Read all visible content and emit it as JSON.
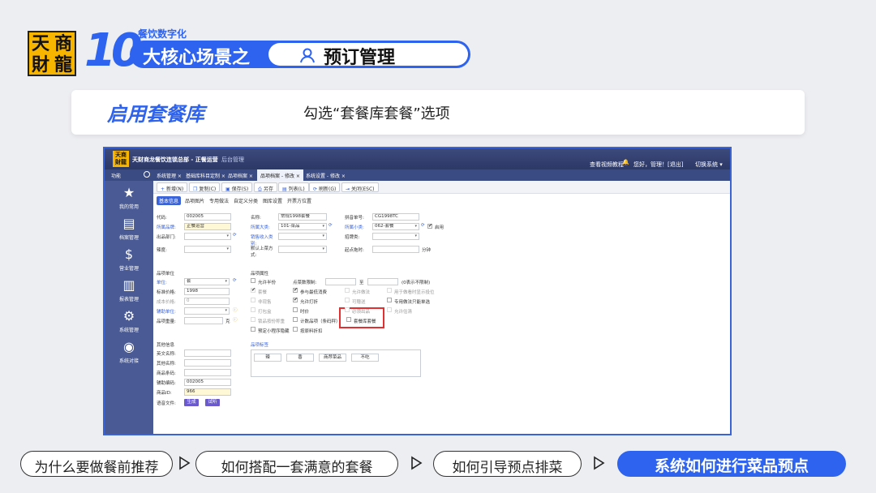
{
  "slide": {
    "logo_chars": [
      "天",
      "商",
      "財",
      "龍"
    ],
    "number": "10",
    "caption": "餐饮数字化",
    "headline": "大核心场景之",
    "scene": "预订管理",
    "section_title": "启用套餐库",
    "instruction": "勾选“套餐库套餐”选项"
  },
  "colors": {
    "accent": "#2e63f0",
    "highlight": "#e23030",
    "sidebar": "#4a5a94"
  },
  "app": {
    "title": "天财商龙餐饮连锁总部 - 正餐运营",
    "title_suffix": "后台管理",
    "help": "查看视频教程",
    "greeting": "您好，管理！[退出]",
    "switch": "切换系统 ▾",
    "function_label": "功能",
    "tabs": [
      "系统管理 ×",
      "基础库科目定制 ×",
      "品项档案 ×",
      "品项档案 - 修改 ×",
      "系统设置 - 修改 ×"
    ],
    "sidebar": [
      {
        "icon": "★",
        "icon_name": "star-icon",
        "label": "我的常用"
      },
      {
        "icon": "▤",
        "icon_name": "list-icon",
        "label": "档案管理"
      },
      {
        "icon": "$",
        "icon_name": "money-bag-icon",
        "label": "营业管理"
      },
      {
        "icon": "▥",
        "icon_name": "report-icon",
        "label": "报表管理"
      },
      {
        "icon": "⚙",
        "icon_name": "gears-icon",
        "label": "系统管理"
      },
      {
        "icon": "◉",
        "icon_name": "dashboard-icon",
        "label": "系统对接"
      }
    ],
    "toolbar": [
      {
        "icon": "+",
        "label": "新增(N)"
      },
      {
        "icon": "❐",
        "label": "复制(C)"
      },
      {
        "icon": "▣",
        "label": "保存(S)"
      },
      {
        "icon": "⎙",
        "label": "另存"
      },
      {
        "icon": "▤",
        "label": "列表(L)"
      },
      {
        "icon": "⟳",
        "label": "刷新(G)"
      },
      {
        "icon": "⇥",
        "label": "关闭(ESC)"
      }
    ],
    "subtabs": [
      "基本信息",
      "品项图片",
      "专用做法",
      "自定义分类",
      "图库设置",
      "开票方位置"
    ],
    "form": {
      "code_label": "代码:",
      "code": "002005",
      "name_label": "名称:",
      "name": "常规1998套餐",
      "pinyin_label": "拼音单号:",
      "pinyin": "CG1998TC",
      "brand_label": "所属品牌:",
      "brand": "正餐运营",
      "bigcat_label": "所属大类:",
      "bigcat": "101-菜品",
      "smallcat_label": "所属小类:",
      "smallcat": "062-套餐",
      "enabled": "启用",
      "dept_label": "出品部门:",
      "sell_label": "销售收入类别:",
      "tag_label": "招牌类:",
      "temp_label": "辣度:",
      "serve_label": "默认上菜方式:",
      "time_label": "起点拖时:",
      "minutes": "分钟",
      "unit_section": "品项单位",
      "unit_label": "单位:",
      "unit": "套",
      "price_label": "标准价格:",
      "price": "1998",
      "cost_label": "成本价格:",
      "cost": "0",
      "aux_label": "辅助单位:",
      "weight_label": "品项重量:",
      "weight_unit": "克",
      "prop_section": "品项属性",
      "halfportion": "允许半份",
      "minbuy_label": "点菜数限制:",
      "to": "至",
      "nolimit": "(0表示不限制)",
      "props": [
        {
          "label": "套餐",
          "checked": true,
          "disabled": true
        },
        {
          "label": "参与最低消费",
          "checked": true,
          "disabled": false
        },
        {
          "label": "允许做法",
          "checked": false,
          "disabled": true
        },
        {
          "label": "用于做看时显示投位",
          "checked": false,
          "disabled": true
        },
        {
          "label": "非现售",
          "checked": false,
          "disabled": true
        },
        {
          "label": "允许打折",
          "checked": true,
          "disabled": false
        },
        {
          "label": "可赠送",
          "checked": false,
          "disabled": true
        },
        {
          "label": "专用做法只能单选",
          "checked": false,
          "disabled": false
        },
        {
          "label": "打包盒",
          "checked": false,
          "disabled": true
        },
        {
          "label": "时价",
          "checked": false,
          "disabled": false
        },
        {
          "label": "必须出品",
          "checked": false,
          "disabled": true
        },
        {
          "label": "允许估清",
          "checked": false,
          "disabled": true
        },
        {
          "label": "锁品按份称重",
          "checked": false,
          "disabled": true
        },
        {
          "label": "计数品项（条码秤）",
          "checked": false,
          "disabled": false
        },
        {
          "label": "套餐库套餐",
          "checked": false,
          "disabled": false
        },
        {
          "label": "预定小程序隐藏",
          "checked": false,
          "disabled": false
        },
        {
          "label": "按原料折扣",
          "checked": false,
          "disabled": false
        }
      ],
      "other_section": "其他信息",
      "english_label": "英文名称:",
      "other_name_label": "其他名称:",
      "item_barcode_label": "商品条码:",
      "aux_code_label": "辅助编码:",
      "aux_code": "002005",
      "item_id_label": "商品ID:",
      "item_id": "966",
      "voice_label": "语音文件:",
      "gen_btn": "生成",
      "listen_btn": "试听",
      "tags_section": "品项标签",
      "tags": [
        "辣",
        "香",
        "商荐菜品",
        "不吃"
      ]
    }
  },
  "nav": {
    "items": [
      "为什么要做餐前推荐",
      "如何搭配一套满意的套餐",
      "如何引导预点排菜",
      "系统如何进行菜品预点"
    ],
    "active_index": 3
  }
}
